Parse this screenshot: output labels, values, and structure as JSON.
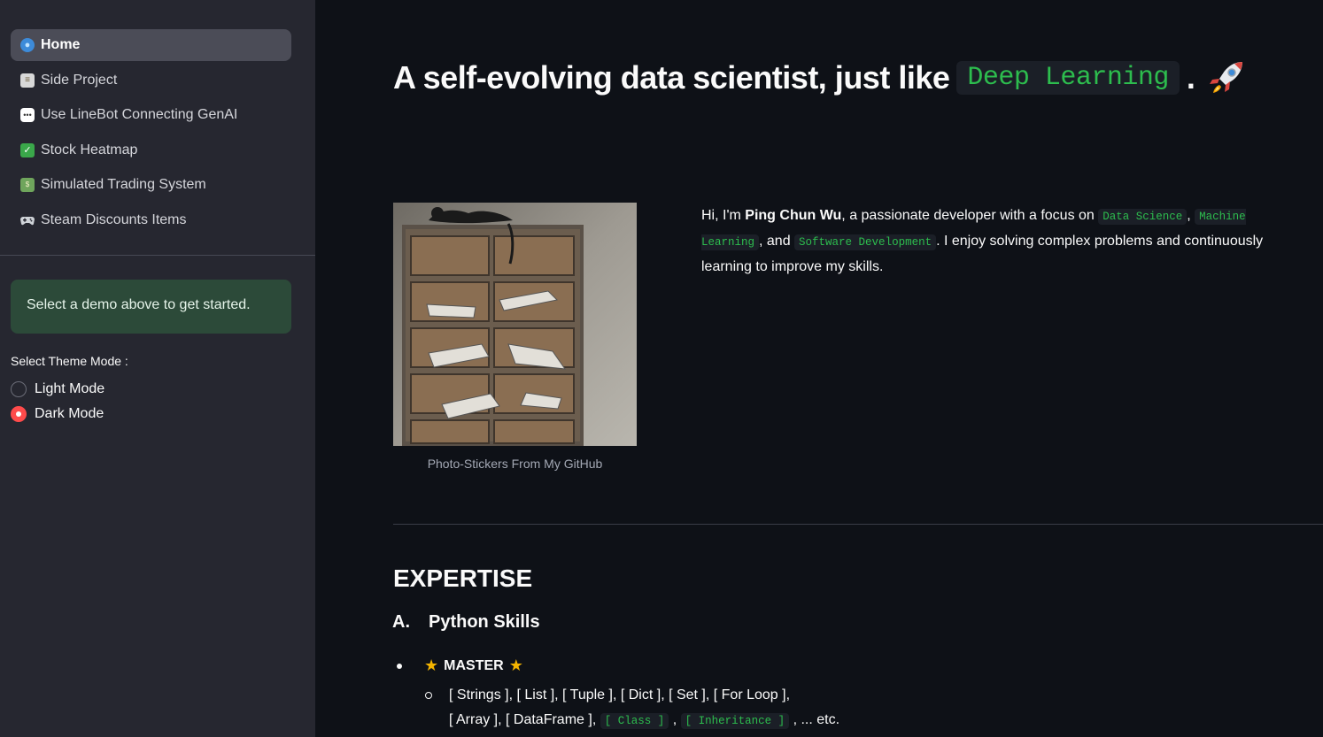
{
  "sidebar": {
    "nav": [
      {
        "label": "Home",
        "icon": "globe-icon",
        "active": true
      },
      {
        "label": "Side Project",
        "icon": "clipboard-icon"
      },
      {
        "label": "Use LineBot Connecting GenAI",
        "icon": "speech-bubble-icon"
      },
      {
        "label": "Stock Heatmap",
        "icon": "check-mark-icon"
      },
      {
        "label": "Simulated Trading System",
        "icon": "banknote-icon"
      },
      {
        "label": "Steam Discounts Items",
        "icon": "game-controller-icon"
      }
    ],
    "info": "Select a demo above to get started.",
    "theme": {
      "label": "Select Theme Mode :",
      "options": [
        "Light Mode",
        "Dark Mode"
      ],
      "selected": "Dark Mode"
    }
  },
  "main": {
    "title": {
      "prefix": "A self-evolving data scientist, just like",
      "code": "Deep Learning",
      "suffix": ".",
      "emoji": "rocket-icon"
    },
    "photo_caption": "Photo-Stickers From My GitHub",
    "intro": {
      "t1": "Hi, I'm ",
      "name": "Ping Chun Wu",
      "t2": ", a passionate developer with a focus on ",
      "c1": "Data Science",
      "t3": ", ",
      "c2": "Machine Learning",
      "t4": ", and ",
      "c3": "Software Development",
      "t5": ". I enjoy solving complex problems and continuously learning to improve my skills."
    },
    "expertise_heading": "EXPERTISE",
    "section": {
      "letter": "A.",
      "title": "Python Skills"
    },
    "master": "MASTER",
    "skills": {
      "line1": "[ Strings ], [ List ], [ Tuple ], [ Dict ], [ Set ], [ For Loop ],",
      "line2a": "[ Array ], [ DataFrame ],",
      "c1": "[ Class ]",
      "sep": ",",
      "c2": "[ Inheritance ]",
      "tail": ", ... etc."
    }
  },
  "colors": {
    "accent": "#ff4b4b",
    "code_green": "#2dbd4e",
    "info_bg": "#2c4a39",
    "sidebar_bg": "#262730",
    "main_bg": "#0e1117"
  }
}
